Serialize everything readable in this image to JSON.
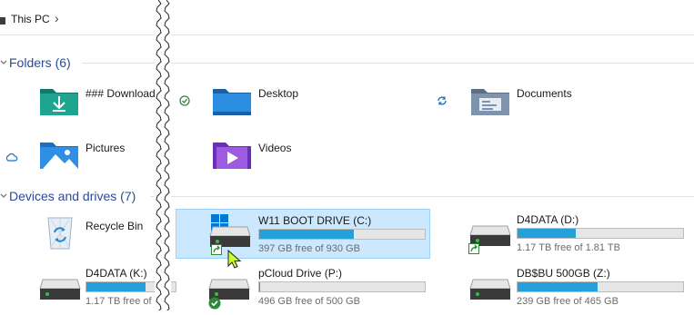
{
  "breadcrumb": {
    "location": "This PC",
    "separator": "›"
  },
  "sections": {
    "folders": {
      "title": "Folders (6)"
    },
    "devices": {
      "title": "Devices and drives (7)"
    }
  },
  "folders": [
    {
      "label": "### Download",
      "icon": "download-folder-icon"
    },
    {
      "label": "Desktop",
      "icon": "desktop-folder-icon"
    },
    {
      "label": "Documents",
      "icon": "documents-folder-icon"
    },
    {
      "label": "Pictures",
      "icon": "pictures-folder-icon"
    },
    {
      "label": "Videos",
      "icon": "videos-folder-icon"
    }
  ],
  "drives": [
    {
      "label": "Recycle Bin"
    },
    {
      "label": "W11 BOOT DRIVE (C:)",
      "free": "397 GB free of 930 GB",
      "used_fraction": 0.573
    },
    {
      "label": "D4DATA (D:)",
      "free": "1.17 TB free of 1.81 TB",
      "used_fraction": 0.354
    },
    {
      "label": "D4DATA (K:)",
      "free": "1.17 TB free of",
      "used_fraction": 0.354
    },
    {
      "label": "pCloud Drive (P:)",
      "free": "496 GB free of 500 GB",
      "used_fraction": 0.008
    },
    {
      "label": "DB$BU 500GB (Z:)",
      "free": "239 GB free of 465 GB",
      "used_fraction": 0.486
    }
  ],
  "colors": {
    "accent": "#26a0da",
    "selection": "#cce8ff",
    "section_title": "#2a4a9a"
  }
}
